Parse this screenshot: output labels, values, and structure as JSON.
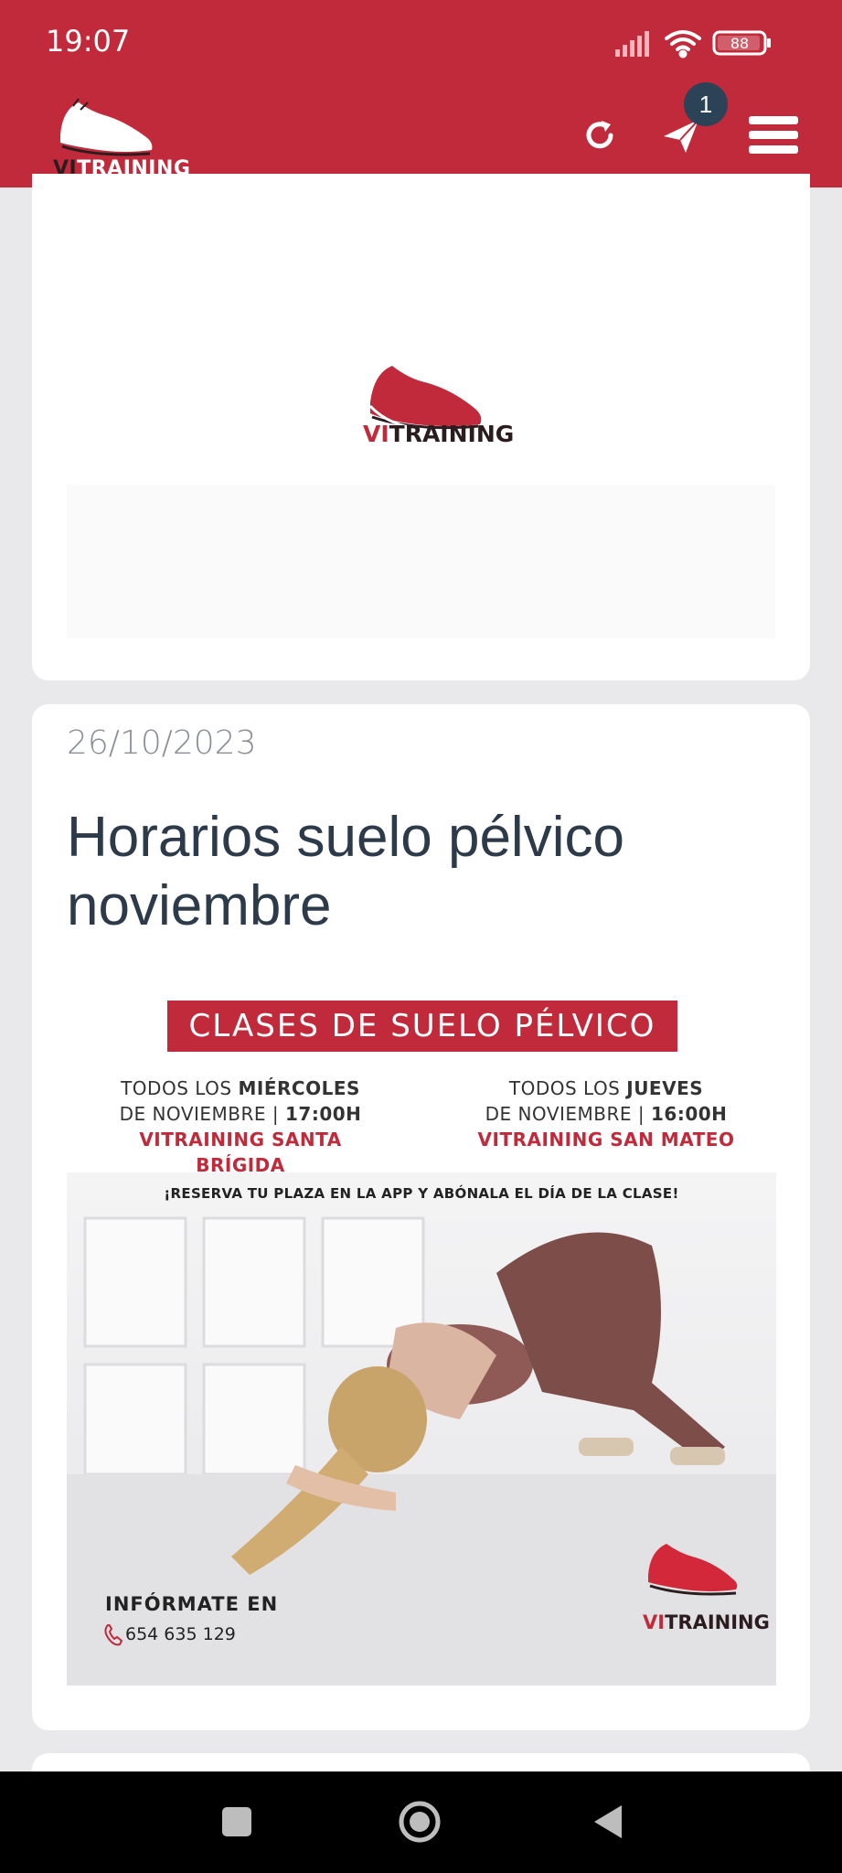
{
  "status_bar": {
    "time": "19:07",
    "battery": "88",
    "icons": [
      "signal-icon",
      "wifi-icon",
      "battery-icon"
    ]
  },
  "app_bar": {
    "logo_prefix": "VI",
    "logo_suffix": "TRAINING",
    "notification_count": "1",
    "icons": [
      "refresh-icon",
      "send-icon",
      "menu-icon"
    ]
  },
  "placeholder_card": {
    "logo_prefix": "VI",
    "logo_suffix": "TRAINING"
  },
  "post": {
    "date": "26/10/2023",
    "title": "Horarios suelo pélvico noviembre",
    "poster": {
      "heading": "CLASES DE SUELO PÉLVICO",
      "left_schedule": {
        "line1_prefix": "TODOS LOS ",
        "line1_day": "MIÉRCOLES",
        "line2_prefix": "DE NOVIEMBRE | ",
        "line2_time": "17:00H",
        "location": "VITRAINING SANTA BRÍGIDA"
      },
      "right_schedule": {
        "line1_prefix": "TODOS LOS ",
        "line1_day": "JUEVES",
        "line2_prefix": "DE NOVIEMBRE | ",
        "line2_time": "16:00H",
        "location": "VITRAINING SAN MATEO"
      },
      "reserve_text": "¡RESERVA TU PLAZA EN LA APP Y ABÓNALA EL DÍA DE LA CLASE!",
      "info_label": "INFÓRMATE EN",
      "phone": "654 635 129",
      "logo_prefix": "VI",
      "logo_suffix": "TRAINING"
    }
  },
  "colors": {
    "brand_red": "#c12a3a",
    "badge": "#2c4257",
    "title_text": "#2c3a4a"
  }
}
